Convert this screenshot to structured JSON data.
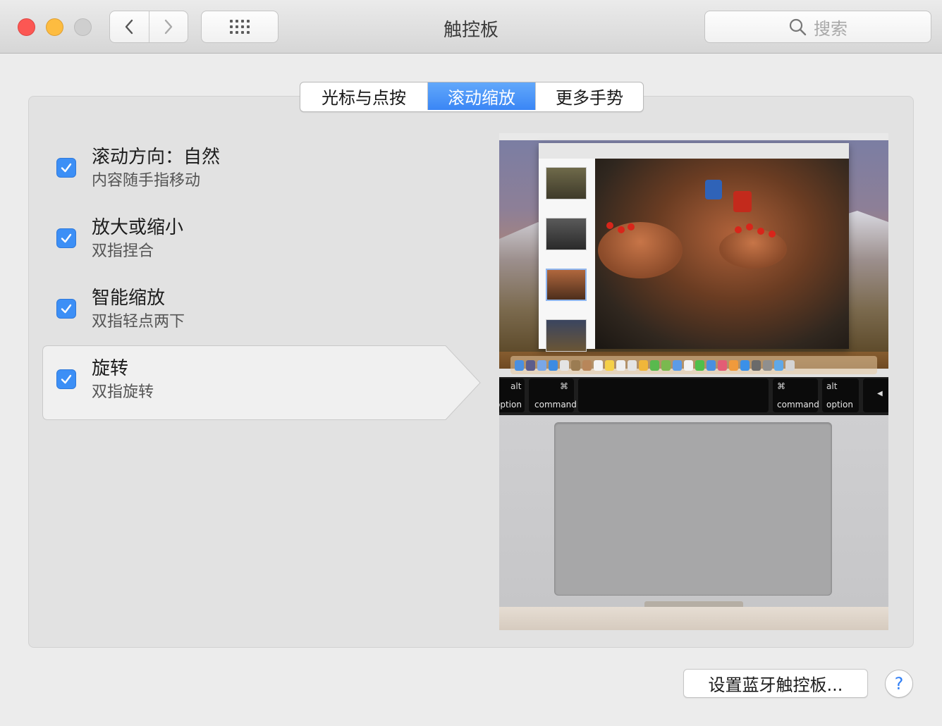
{
  "window": {
    "title": "触控板",
    "search_placeholder": "搜索"
  },
  "tabs": [
    {
      "label": "光标与点按",
      "active": false
    },
    {
      "label": "滚动缩放",
      "active": true
    },
    {
      "label": "更多手势",
      "active": false
    }
  ],
  "options": [
    {
      "title": "滚动方向：自然",
      "subtitle": "内容随手指移动",
      "checked": true
    },
    {
      "title": "放大或缩小",
      "subtitle": "双指捏合",
      "checked": true
    },
    {
      "title": "智能缩放",
      "subtitle": "双指轻点两下",
      "checked": true
    },
    {
      "title": "旋转",
      "subtitle": "双指旋转",
      "checked": true,
      "selected": true
    }
  ],
  "preview": {
    "keys": [
      {
        "symbol": "alt",
        "label": "option"
      },
      {
        "symbol": "⌘",
        "label": "command"
      },
      {
        "symbol": "⌘",
        "label": "command"
      },
      {
        "symbol": "alt",
        "label": "option"
      },
      {
        "symbol": "◀",
        "label": ""
      }
    ]
  },
  "footer": {
    "bluetooth_button": "设置蓝牙触控板...",
    "help_label": "?"
  },
  "colors": {
    "accent": "#3c8ff6",
    "close": "#fc5753",
    "minimize": "#fdbc40"
  }
}
